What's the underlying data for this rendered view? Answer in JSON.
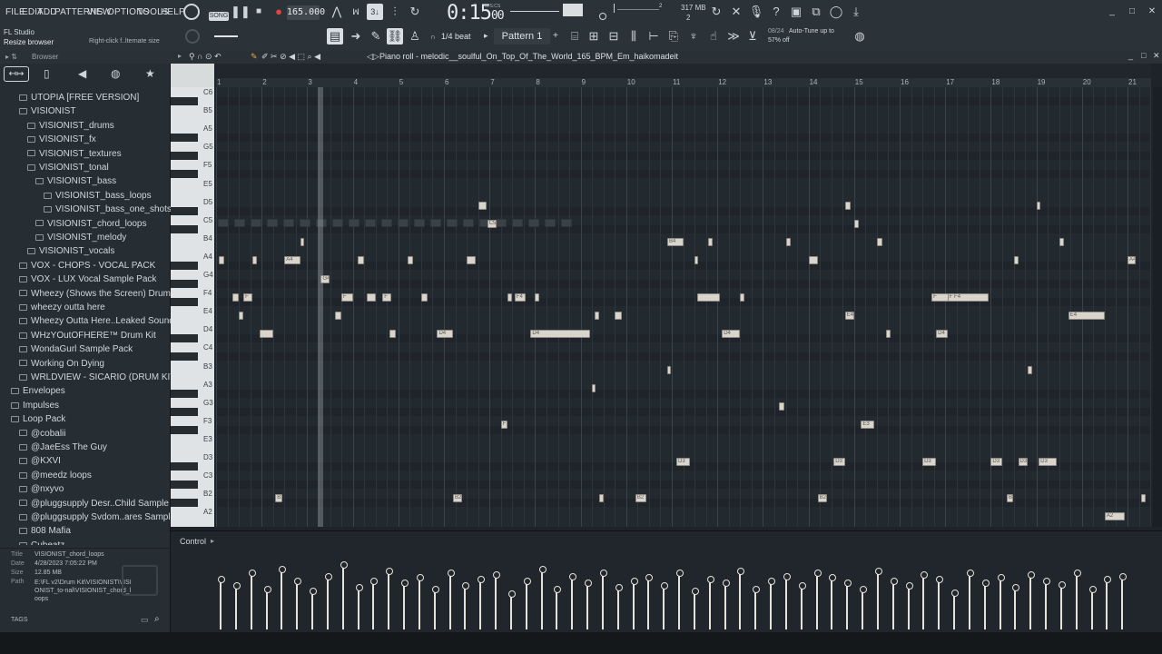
{
  "menu": [
    "FILE",
    "EDIT",
    "ADD",
    "PATTERNS",
    "VIEW",
    "OPTIONS",
    "TOOLS",
    "HELP"
  ],
  "toolbar": {
    "song_label": "SONG",
    "tempo": "165.000",
    "time": "0:15",
    "time_frac": "00",
    "time_unit": "M:S:CS",
    "memory": "317 MB",
    "memory_sub": "2",
    "snap": "1/4 beat",
    "pattern": "Pattern 1",
    "hint_date": "08/24",
    "hint_text": "Auto-Tune up to",
    "hint_text2": "57% off"
  },
  "app": {
    "title": "FL Studio",
    "hint": "Resize browser",
    "hint_right": "Right-click f..lternate size"
  },
  "browser": {
    "title": "Browser",
    "items": [
      {
        "label": "UTOPIA [FREE VERSION]",
        "indent": 1
      },
      {
        "label": "VISIONIST",
        "indent": 1
      },
      {
        "label": "VISIONIST_drums",
        "indent": 2
      },
      {
        "label": "VISIONIST_fx",
        "indent": 2
      },
      {
        "label": "VISIONIST_textures",
        "indent": 2
      },
      {
        "label": "VISIONIST_tonal",
        "indent": 2
      },
      {
        "label": "VISIONIST_bass",
        "indent": 3
      },
      {
        "label": "VISIONIST_bass_loops",
        "indent": 4
      },
      {
        "label": "VISIONIST_bass_one_shots",
        "indent": 4
      },
      {
        "label": "VISIONIST_chord_loops",
        "indent": 3
      },
      {
        "label": "VISIONIST_melody",
        "indent": 3
      },
      {
        "label": "VISIONIST_vocals",
        "indent": 2
      },
      {
        "label": "VOX - CHOPS - VOCAL PACK",
        "indent": 1
      },
      {
        "label": "VOX - LUX Vocal Sample Pack",
        "indent": 1
      },
      {
        "label": "Wheezy (Shows the Screen) Drumkit",
        "indent": 1
      },
      {
        "label": "wheezy outta here",
        "indent": 1
      },
      {
        "label": "Wheezy Outta Here..Leaked Sounds KiT",
        "indent": 1
      },
      {
        "label": "WHzYOutOFHERE™ Drum Kit",
        "indent": 1
      },
      {
        "label": "WondaGurl Sample Pack",
        "indent": 1
      },
      {
        "label": "Working On Dying",
        "indent": 1
      },
      {
        "label": "WRLDVIEW - SICARIO (DRUM KIT)",
        "indent": 1
      },
      {
        "label": "Envelopes",
        "indent": 0
      },
      {
        "label": "Impulses",
        "indent": 0
      },
      {
        "label": "Loop Pack",
        "indent": 0
      },
      {
        "label": "@cobalii",
        "indent": 1
      },
      {
        "label": "@JaeEss The Guy",
        "indent": 1
      },
      {
        "label": "@KXVI",
        "indent": 1
      },
      {
        "label": "@meedz loops",
        "indent": 1
      },
      {
        "label": "@nxyvo",
        "indent": 1
      },
      {
        "label": "@pluggsupply Desr..Child Sample Pack",
        "indent": 1
      },
      {
        "label": "@pluggsupply Svdom..ares Sample Pack",
        "indent": 1
      },
      {
        "label": "808 Mafia",
        "indent": 1
      },
      {
        "label": "Cubeatz",
        "indent": 1
      }
    ],
    "info": {
      "title_label": "Title",
      "title": "VISIONIST_chord_loops",
      "date_label": "Date",
      "date": "4/28/2023 7:05:22 PM",
      "size_label": "Size",
      "size": "12.85 MB",
      "path_label": "Path",
      "path": "E:\\FL v2\\Drum Kit\\VISIONIST\\VISIONIST_to-nal\\VISIONIST_chord_loops"
    },
    "tags": "TAGS"
  },
  "piano_roll": {
    "title": "Piano roll - melodic__soulful_On_Top_Of_The_World_165_BPM_Em_haikomadeit",
    "control_label": "Control",
    "bars": [
      "1",
      "2",
      "3",
      "4",
      "5",
      "6",
      "7",
      "8",
      "9",
      "10",
      "11",
      "12",
      "13",
      "14",
      "15",
      "16",
      "17",
      "18",
      "19",
      "20",
      "21"
    ],
    "keys": [
      "C6",
      "B5",
      "A5",
      "G5",
      "F5",
      "E5",
      "D5",
      "C5",
      "B4",
      "A4",
      "G4",
      "F4",
      "E4",
      "D4",
      "C4",
      "B3",
      "A3",
      "G3",
      "F3",
      "E3",
      "D3",
      "C3",
      "B2",
      "A2"
    ],
    "notes": [
      {
        "row": 6,
        "bar": 6.75,
        "len": 0.18,
        "label": ""
      },
      {
        "row": 6,
        "bar": 14.8,
        "len": 0.12,
        "label": ""
      },
      {
        "row": 6,
        "bar": 19.0,
        "len": 0.08,
        "label": ""
      },
      {
        "row": 7,
        "bar": 6.95,
        "len": 0.2,
        "label": "C5"
      },
      {
        "row": 7,
        "bar": 15.0,
        "len": 0.1,
        "label": ""
      },
      {
        "row": 8,
        "bar": 2.85,
        "len": 0.05,
        "label": ""
      },
      {
        "row": 8,
        "bar": 10.9,
        "len": 0.35,
        "label": "B4"
      },
      {
        "row": 8,
        "bar": 11.8,
        "len": 0.1,
        "label": ""
      },
      {
        "row": 8,
        "bar": 13.5,
        "len": 0.1,
        "label": ""
      },
      {
        "row": 8,
        "bar": 15.5,
        "len": 0.12,
        "label": ""
      },
      {
        "row": 8,
        "bar": 19.5,
        "len": 0.1,
        "label": ""
      },
      {
        "row": 9,
        "bar": 1.05,
        "len": 0.12,
        "label": ""
      },
      {
        "row": 9,
        "bar": 1.8,
        "len": 0.1,
        "label": ""
      },
      {
        "row": 9,
        "bar": 2.5,
        "len": 0.35,
        "label": "A4"
      },
      {
        "row": 9,
        "bar": 4.1,
        "len": 0.15,
        "label": ""
      },
      {
        "row": 9,
        "bar": 5.2,
        "len": 0.12,
        "label": ""
      },
      {
        "row": 9,
        "bar": 6.5,
        "len": 0.2,
        "label": ""
      },
      {
        "row": 9,
        "bar": 11.5,
        "len": 0.08,
        "label": ""
      },
      {
        "row": 9,
        "bar": 14.0,
        "len": 0.2,
        "label": ""
      },
      {
        "row": 9,
        "bar": 18.5,
        "len": 0.1,
        "label": ""
      },
      {
        "row": 9,
        "bar": 21.0,
        "len": 0.18,
        "label": "A4"
      },
      {
        "row": 10,
        "bar": 3.3,
        "len": 0.2,
        "label": "G4"
      },
      {
        "row": 11,
        "bar": 1.35,
        "len": 0.15,
        "label": ""
      },
      {
        "row": 11,
        "bar": 1.6,
        "len": 0.2,
        "label": "F"
      },
      {
        "row": 11,
        "bar": 3.75,
        "len": 0.25,
        "label": "F"
      },
      {
        "row": 11,
        "bar": 4.3,
        "len": 0.2,
        "label": ""
      },
      {
        "row": 11,
        "bar": 4.65,
        "len": 0.2,
        "label": "F"
      },
      {
        "row": 11,
        "bar": 5.5,
        "len": 0.15,
        "label": ""
      },
      {
        "row": 11,
        "bar": 7.4,
        "len": 0.1,
        "label": ""
      },
      {
        "row": 11,
        "bar": 7.55,
        "len": 0.25,
        "label": "F4"
      },
      {
        "row": 11,
        "bar": 8.0,
        "len": 0.1,
        "label": ""
      },
      {
        "row": 11,
        "bar": 11.55,
        "len": 0.5,
        "label": ""
      },
      {
        "row": 11,
        "bar": 12.5,
        "len": 0.1,
        "label": ""
      },
      {
        "row": 11,
        "bar": 16.7,
        "len": 0.45,
        "label": "F"
      },
      {
        "row": 11,
        "bar": 17.05,
        "len": 0.9,
        "label": "F F4"
      },
      {
        "row": 12,
        "bar": 1.5,
        "len": 0.1,
        "label": ""
      },
      {
        "row": 12,
        "bar": 3.6,
        "len": 0.15,
        "label": ""
      },
      {
        "row": 12,
        "bar": 9.3,
        "len": 0.1,
        "label": ""
      },
      {
        "row": 12,
        "bar": 9.75,
        "len": 0.15,
        "label": ""
      },
      {
        "row": 12,
        "bar": 14.8,
        "len": 0.2,
        "label": "E4"
      },
      {
        "row": 12,
        "bar": 19.7,
        "len": 0.8,
        "label": "E4"
      },
      {
        "row": 13,
        "bar": 1.95,
        "len": 0.3,
        "label": ""
      },
      {
        "row": 13,
        "bar": 4.8,
        "len": 0.15,
        "label": ""
      },
      {
        "row": 13,
        "bar": 5.85,
        "len": 0.35,
        "label": "D4 D4"
      },
      {
        "row": 13,
        "bar": 7.9,
        "len": 1.3,
        "label": "D4"
      },
      {
        "row": 13,
        "bar": 12.1,
        "len": 0.4,
        "label": "D4"
      },
      {
        "row": 13,
        "bar": 15.7,
        "len": 0.1,
        "label": ""
      },
      {
        "row": 13,
        "bar": 16.8,
        "len": 0.25,
        "label": "D4"
      },
      {
        "row": 15,
        "bar": 10.9,
        "len": 0.06,
        "label": ""
      },
      {
        "row": 15,
        "bar": 18.8,
        "len": 0.1,
        "label": ""
      },
      {
        "row": 16,
        "bar": 9.25,
        "len": 0.05,
        "label": ""
      },
      {
        "row": 17,
        "bar": 13.35,
        "len": 0.12,
        "label": ""
      },
      {
        "row": 18,
        "bar": 7.25,
        "len": 0.15,
        "label": "F"
      },
      {
        "row": 18,
        "bar": 15.15,
        "len": 0.3,
        "label": "E3"
      },
      {
        "row": 20,
        "bar": 11.1,
        "len": 0.3,
        "label": "D3"
      },
      {
        "row": 20,
        "bar": 14.55,
        "len": 0.25,
        "label": "D3"
      },
      {
        "row": 20,
        "bar": 16.5,
        "len": 0.3,
        "label": "D3"
      },
      {
        "row": 20,
        "bar": 18.0,
        "len": 0.25,
        "label": "D3"
      },
      {
        "row": 20,
        "bar": 18.6,
        "len": 0.2,
        "label": "D3"
      },
      {
        "row": 20,
        "bar": 19.05,
        "len": 0.4,
        "label": "D3"
      },
      {
        "row": 22,
        "bar": 2.3,
        "len": 0.15,
        "label": "B2"
      },
      {
        "row": 22,
        "bar": 6.2,
        "len": 0.2,
        "label": "B2"
      },
      {
        "row": 22,
        "bar": 9.4,
        "len": 0.1,
        "label": ""
      },
      {
        "row": 22,
        "bar": 10.2,
        "len": 0.25,
        "label": "B2"
      },
      {
        "row": 22,
        "bar": 14.2,
        "len": 0.2,
        "label": "B2"
      },
      {
        "row": 22,
        "bar": 18.35,
        "len": 0.15,
        "label": "B2"
      },
      {
        "row": 22,
        "bar": 21.3,
        "len": 0.1,
        "label": ""
      },
      {
        "row": 23,
        "bar": 20.5,
        "len": 0.45,
        "label": "A2"
      }
    ],
    "velocities": [
      0.62,
      0.55,
      0.7,
      0.5,
      0.75,
      0.6,
      0.48,
      0.66,
      0.8,
      0.52,
      0.6,
      0.72,
      0.58,
      0.64,
      0.5,
      0.7,
      0.55,
      0.62,
      0.68,
      0.45,
      0.6,
      0.74,
      0.5,
      0.66,
      0.58,
      0.7,
      0.52,
      0.6,
      0.65,
      0.55,
      0.7,
      0.48,
      0.62,
      0.58,
      0.72,
      0.5,
      0.6,
      0.66,
      0.54,
      0.7,
      0.64,
      0.58,
      0.5,
      0.72,
      0.6,
      0.55,
      0.68,
      0.62,
      0.46,
      0.7,
      0.58,
      0.64,
      0.52,
      0.68,
      0.6,
      0.56,
      0.7,
      0.5,
      0.62,
      0.66
    ]
  }
}
